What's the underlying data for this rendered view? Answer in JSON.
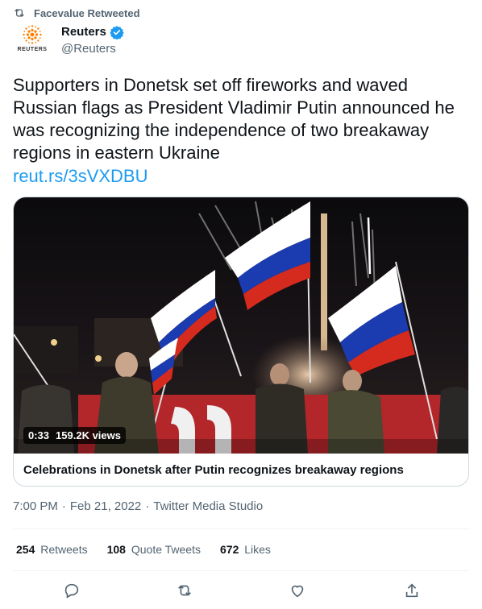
{
  "retweet_context": {
    "text": "Facevalue Retweeted",
    "icon": "retweet-icon"
  },
  "author": {
    "name": "Reuters",
    "handle": "@Reuters",
    "verified": true,
    "logo_text": "REUTERS",
    "brand_color": "#ff8000",
    "verified_color": "#1d9bf0"
  },
  "tweet": {
    "text": "Supporters in Donetsk set off fireworks and waved Russian flags as President Vladimir Putin announced he was recognizing the independence of two breakaway regions in eastern Ukraine",
    "link": "reut.rs/3sVXDBU",
    "link_color": "#1d9bf0"
  },
  "media": {
    "duration": "0:33",
    "views": "159.2K views",
    "caption": "Celebrations in Donetsk after Putin recognizes breakaway regions"
  },
  "meta": {
    "time": "7:00 PM",
    "separator": "·",
    "date": "Feb 21, 2022",
    "source": "Twitter Media Studio"
  },
  "stats": {
    "retweets": {
      "count": "254",
      "label": "Retweets"
    },
    "quote_tweets": {
      "count": "108",
      "label": "Quote Tweets"
    },
    "likes": {
      "count": "672",
      "label": "Likes"
    }
  },
  "actions": [
    "reply-icon",
    "retweet-icon",
    "like-icon",
    "share-icon"
  ]
}
